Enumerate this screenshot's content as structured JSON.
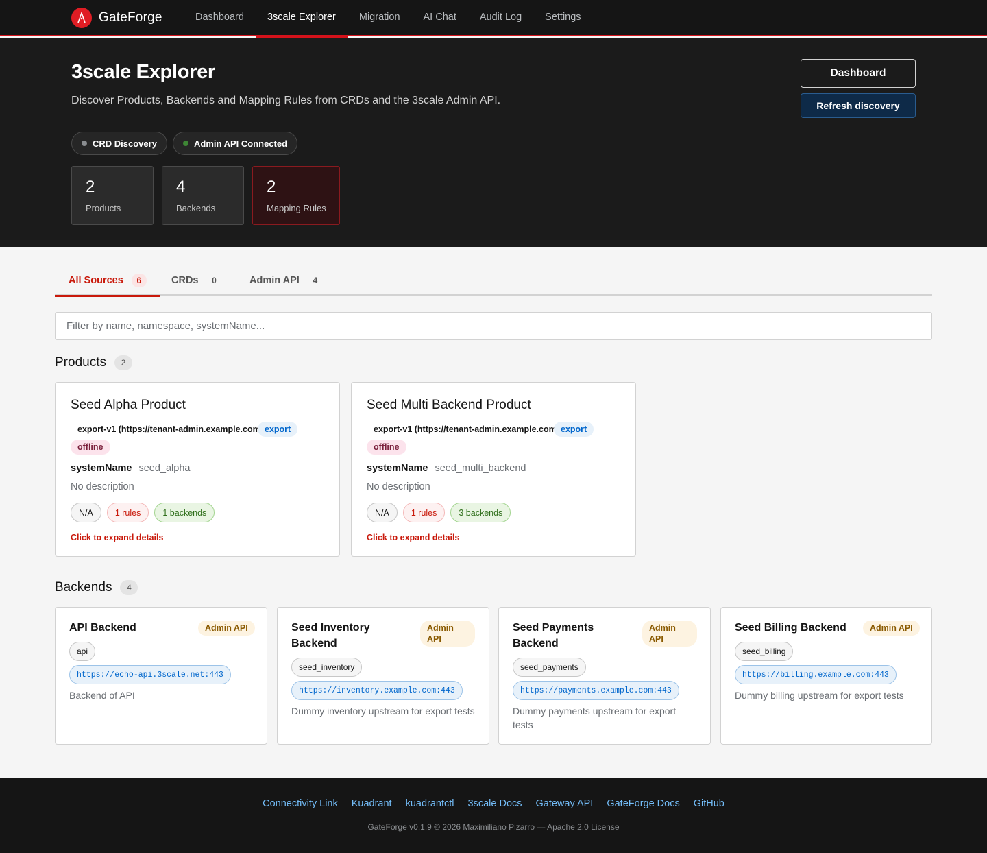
{
  "brand": {
    "name": "GateForge"
  },
  "nav": [
    {
      "label": "Dashboard"
    },
    {
      "label": "3scale Explorer"
    },
    {
      "label": "Migration"
    },
    {
      "label": "AI Chat"
    },
    {
      "label": "Audit Log"
    },
    {
      "label": "Settings"
    }
  ],
  "nav_active": "3scale Explorer",
  "hero": {
    "title": "3scale Explorer",
    "subtitle": "Discover Products, Backends and Mapping Rules from CRDs and the 3scale Admin API.",
    "dashboard_btn": "Dashboard",
    "refresh_btn": "Refresh discovery",
    "pills": [
      {
        "label": "CRD Discovery",
        "dot_color": "#8a8d90"
      },
      {
        "label": "Admin API Connected",
        "dot_color": "#3e8635"
      }
    ],
    "stats": [
      {
        "value": "2",
        "label": "Products"
      },
      {
        "value": "4",
        "label": "Backends"
      },
      {
        "value": "2",
        "label": "Mapping Rules"
      }
    ]
  },
  "tabs": [
    {
      "label": "All Sources",
      "count": "6"
    },
    {
      "label": "CRDs",
      "count": "0"
    },
    {
      "label": "Admin API",
      "count": "4"
    }
  ],
  "filter": {
    "placeholder": "Filter by name, namespace, systemName..."
  },
  "products_section": {
    "title": "Products",
    "count": "2"
  },
  "products": [
    {
      "title": "Seed Alpha Product",
      "source": "export-v1 (https://tenant-admin.example.com)",
      "source_badge": "export",
      "state": "offline",
      "system_label": "systemName",
      "system_name": "seed_alpha",
      "description": "No description",
      "chip_na": "N/A",
      "chip_rules": "1 rules",
      "chip_backends": "1 backends",
      "expand": "Click to expand details"
    },
    {
      "title": "Seed Multi Backend Product",
      "source": "export-v1 (https://tenant-admin.example.com)",
      "source_badge": "export",
      "state": "offline",
      "system_label": "systemName",
      "system_name": "seed_multi_backend",
      "description": "No description",
      "chip_na": "N/A",
      "chip_rules": "1 rules",
      "chip_backends": "3 backends",
      "expand": "Click to expand details"
    }
  ],
  "backends_section": {
    "title": "Backends",
    "count": "4"
  },
  "backends": [
    {
      "title": "API Backend",
      "badge": "Admin API",
      "system_name": "api",
      "url": "https://echo-api.3scale.net:443",
      "description": "Backend of API"
    },
    {
      "title": "Seed Inventory Backend",
      "badge": "Admin API",
      "system_name": "seed_inventory",
      "url": "https://inventory.example.com:443",
      "description": "Dummy inventory upstream for export tests"
    },
    {
      "title": "Seed Payments Backend",
      "badge": "Admin API",
      "system_name": "seed_payments",
      "url": "https://payments.example.com:443",
      "description": "Dummy payments upstream for export tests"
    },
    {
      "title": "Seed Billing Backend",
      "badge": "Admin API",
      "system_name": "seed_billing",
      "url": "https://billing.example.com:443",
      "description": "Dummy billing upstream for export tests"
    }
  ],
  "footer": {
    "links": [
      "Connectivity Link",
      "Kuadrant",
      "kuadrantctl",
      "3scale Docs",
      "Gateway API",
      "GateForge Docs",
      "GitHub"
    ],
    "copyright": "GateForge v0.1.9 © 2026 Maximiliano Pizarro — Apache 2.0 License"
  },
  "colors": {
    "accent": "#d4121b",
    "link": "#73bcf7",
    "primary_btn": "#0e2a48"
  }
}
